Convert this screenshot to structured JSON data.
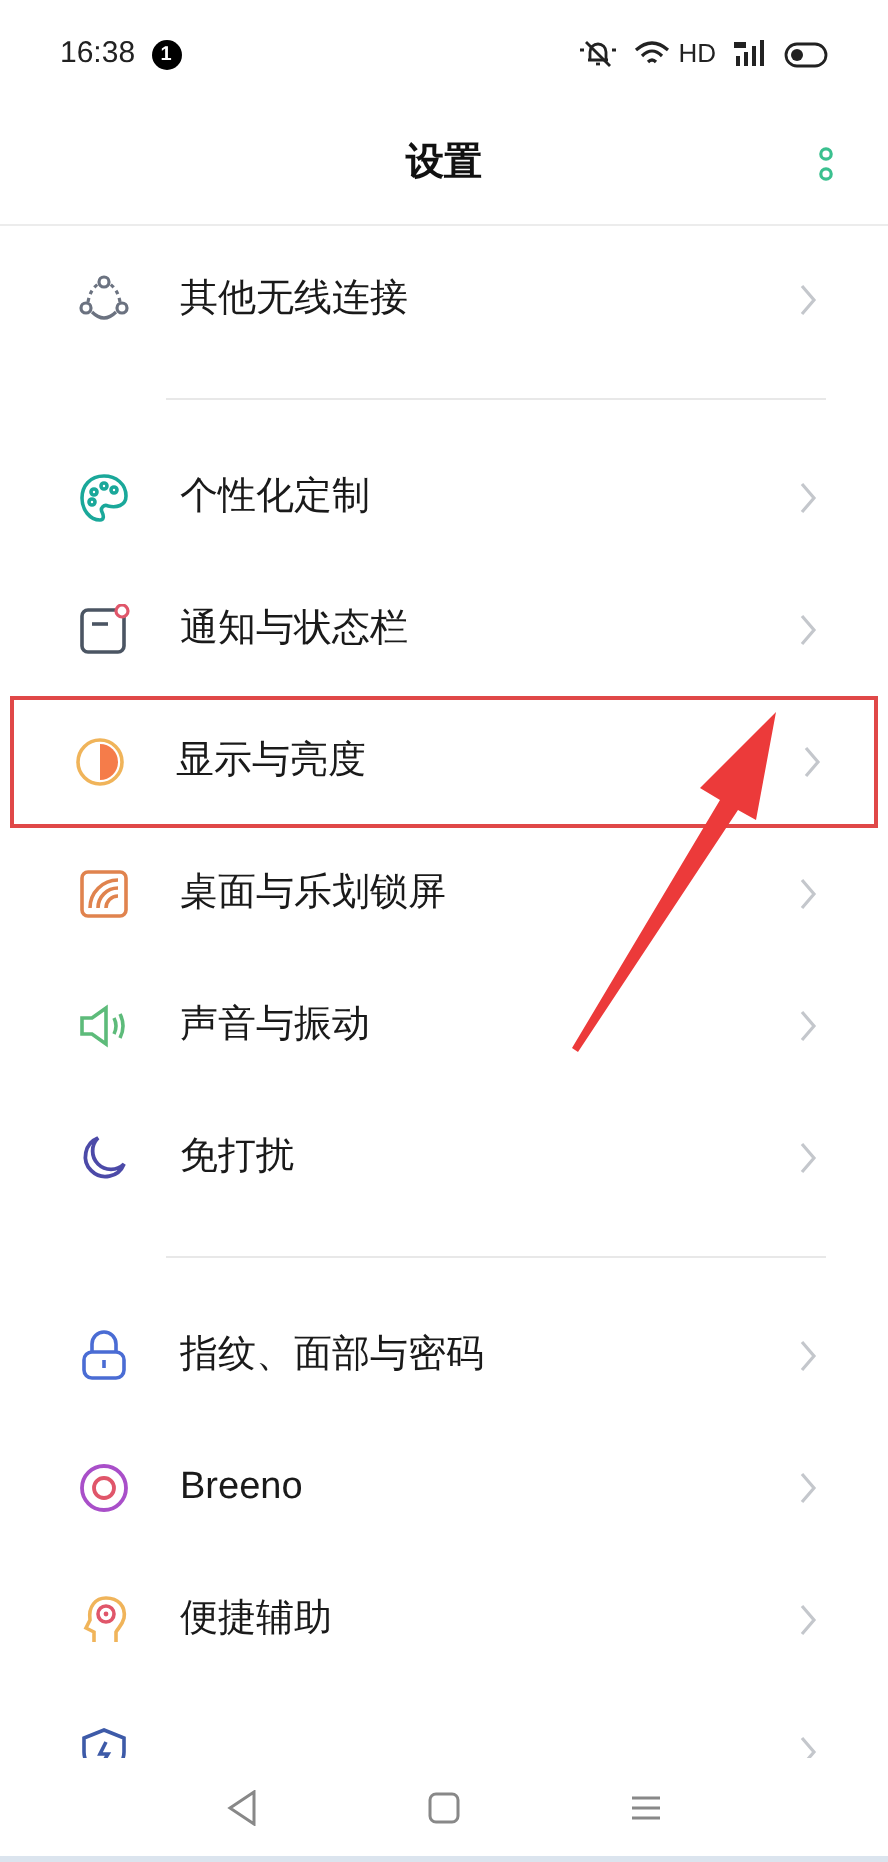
{
  "status_bar": {
    "time": "16:38",
    "notification_count": "1",
    "network_label": "HD"
  },
  "header": {
    "title": "设置"
  },
  "sections": [
    {
      "items": [
        {
          "label": "其他无线连接",
          "highlighted": false
        }
      ]
    },
    {
      "items": [
        {
          "label": "个性化定制",
          "highlighted": false
        },
        {
          "label": "通知与状态栏",
          "highlighted": false
        },
        {
          "label": "显示与亮度",
          "highlighted": true
        },
        {
          "label": "桌面与乐划锁屏",
          "highlighted": false
        },
        {
          "label": "声音与振动",
          "highlighted": false
        },
        {
          "label": "免打扰",
          "highlighted": false
        }
      ]
    },
    {
      "items": [
        {
          "label": "指纹、面部与密码",
          "highlighted": false
        },
        {
          "label": "Breeno",
          "highlighted": false
        },
        {
          "label": "便捷辅助",
          "highlighted": false
        },
        {
          "highlighted": false
        }
      ]
    }
  ],
  "pointer_arrow": true
}
